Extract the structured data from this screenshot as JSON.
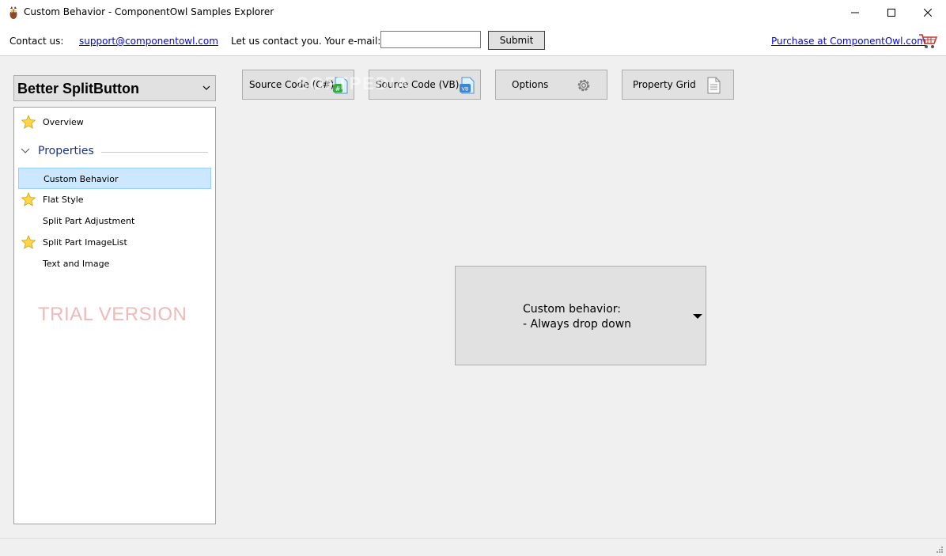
{
  "window": {
    "title": "Custom Behavior - ComponentOwl Samples Explorer",
    "app_icon": "owl-icon",
    "controls": [
      "minimize-icon",
      "maximize-icon",
      "close-icon"
    ]
  },
  "contact_bar": {
    "contact_label": "Contact us:",
    "email_link": "support@componentowl.com",
    "contact_prompt": "Let us contact you. Your e-mail:",
    "email_value": "",
    "submit_label": "Submit",
    "purchase_link": "Purchase at ComponentOwl.com",
    "cart_icon": "shopping-cart-icon"
  },
  "sidebar": {
    "component_select": "Better SplitButton",
    "items": [
      {
        "label": "Overview",
        "starred": true
      },
      {
        "label": "Custom Behavior",
        "starred": false,
        "selected": true
      },
      {
        "label": "Flat Style",
        "starred": true
      },
      {
        "label": "Split Part Adjustment",
        "starred": false
      },
      {
        "label": "Split Part ImageList",
        "starred": true
      },
      {
        "label": "Text and Image",
        "starred": false
      }
    ],
    "group_label": "Properties",
    "trial_text": "TRIAL VERSION"
  },
  "toolbar": {
    "buttons": [
      {
        "label": "Source Code (C#)",
        "icon": "csharp-file-icon"
      },
      {
        "label": "Source Code (VB)",
        "icon": "vb-file-icon"
      },
      {
        "label": "Options",
        "icon": "gear-icon"
      },
      {
        "label": "Property Grid",
        "icon": "document-icon"
      }
    ],
    "watermark": "SOFTPEDIA"
  },
  "demo": {
    "split_button_line1": "Custom behavior:",
    "split_button_line2": "- Always drop down",
    "arrow_icon": "dropdown-arrow-icon"
  },
  "colors": {
    "selection": "#cce8ff",
    "group_header": "#1e3287",
    "trial": "#f0b8b8",
    "link": "#0000ee"
  }
}
